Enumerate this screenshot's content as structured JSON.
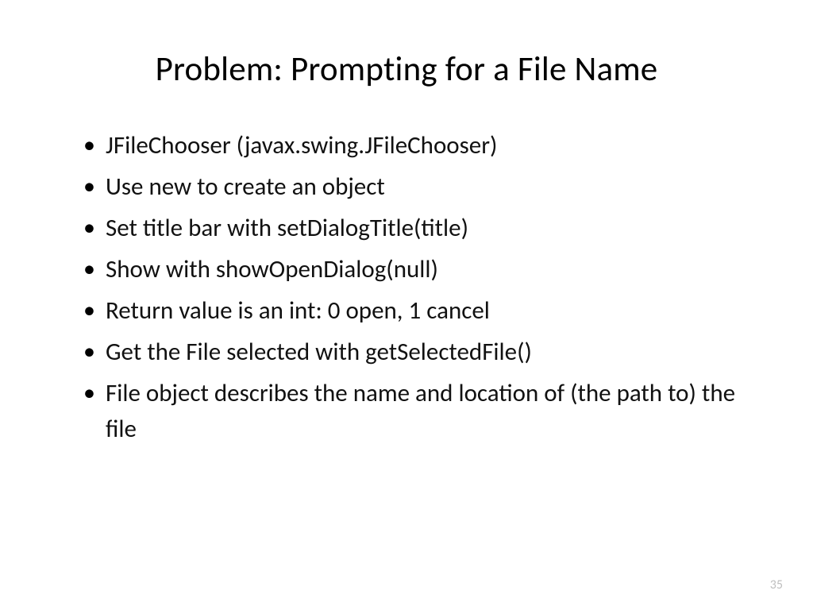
{
  "slide": {
    "title": "Problem: Prompting for a File Name",
    "bullets": [
      "JFileChooser (javax.swing.JFileChooser)",
      "Use new to create an object",
      "Set title bar with setDialogTitle(title)",
      "Show with showOpenDialog(null)",
      "Return value is an int: 0 open, 1 cancel",
      "Get the File selected with getSelectedFile()",
      "File object describes the name and location of (the path to) the file"
    ],
    "page_number": "35"
  }
}
